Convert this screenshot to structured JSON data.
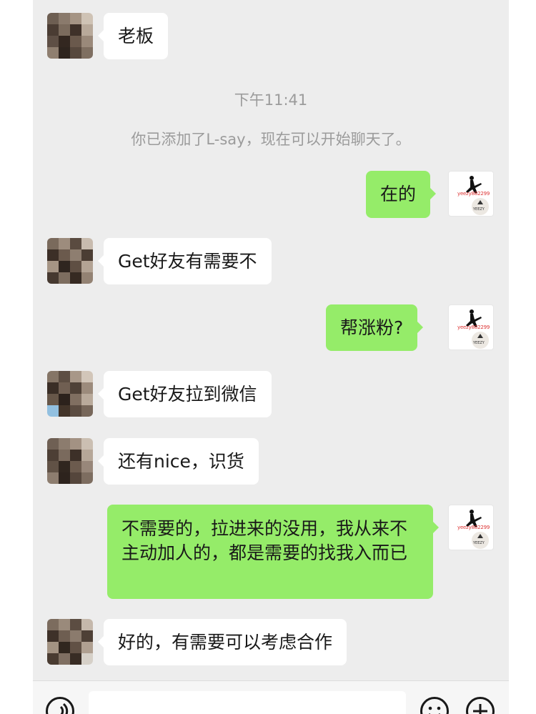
{
  "time_divider": "下午11:41",
  "system_notice": "你已添加了L-say，现在可以开始聊天了。",
  "self_avatar": {
    "watermark": "yeezy882299",
    "brand": "YEEZY"
  },
  "messages": [
    {
      "from": "them",
      "text": "老板"
    },
    {
      "from": "me",
      "text": "在的"
    },
    {
      "from": "them",
      "text": "Get好友有需要不"
    },
    {
      "from": "me",
      "text": "帮涨粉?"
    },
    {
      "from": "them",
      "text": "Get好友拉到微信"
    },
    {
      "from": "them",
      "text": "还有nice，识货"
    },
    {
      "from": "me",
      "text": "不需要的，拉进来的没用，我从来不主动加人的，都是需要的找我入而已"
    },
    {
      "from": "them",
      "text": "好的，有需要可以考虑合作"
    }
  ],
  "input_bar": {
    "voice_icon": "voice-icon",
    "emoji_icon": "emoji-icon",
    "more_icon": "plus-icon"
  },
  "colors": {
    "chat_background": "#ededed",
    "outgoing_bubble": "#95ec69",
    "incoming_bubble": "#ffffff",
    "system_text": "#9b9b9b"
  }
}
